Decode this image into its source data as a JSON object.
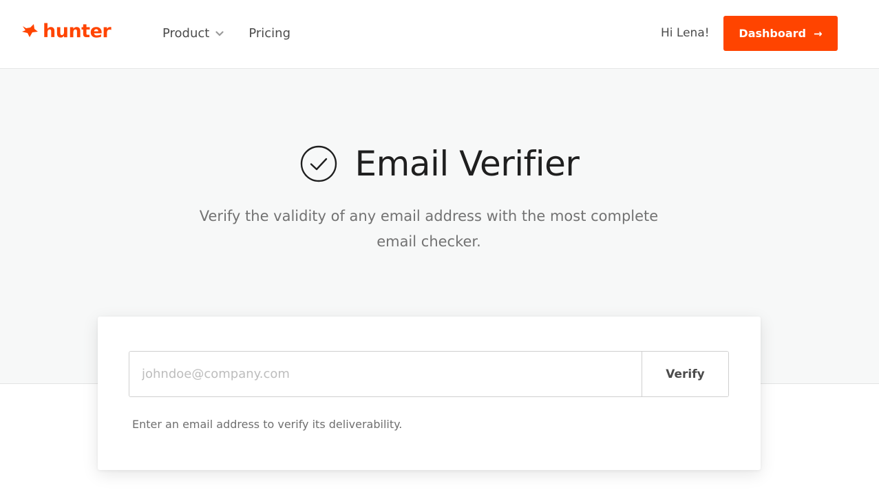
{
  "brand": {
    "name": "hunter",
    "accent_color": "#ff4400",
    "logo_icon": "fox-head-icon"
  },
  "header": {
    "nav": [
      {
        "label": "Product",
        "icon": "chevron-down-icon"
      },
      {
        "label": "Pricing"
      }
    ],
    "greeting": "Hi Lena!",
    "dashboard_button": {
      "label": "Dashboard",
      "icon": "→"
    }
  },
  "hero": {
    "icon": "check-circle-icon",
    "title": "Email Verifier",
    "subtitle": "Verify the validity of any email address with the most complete email checker."
  },
  "form": {
    "email_input": {
      "placeholder": "johndoe@company.com",
      "value": ""
    },
    "verify_button": "Verify",
    "helper_text": "Enter an email address to verify its deliverability."
  }
}
